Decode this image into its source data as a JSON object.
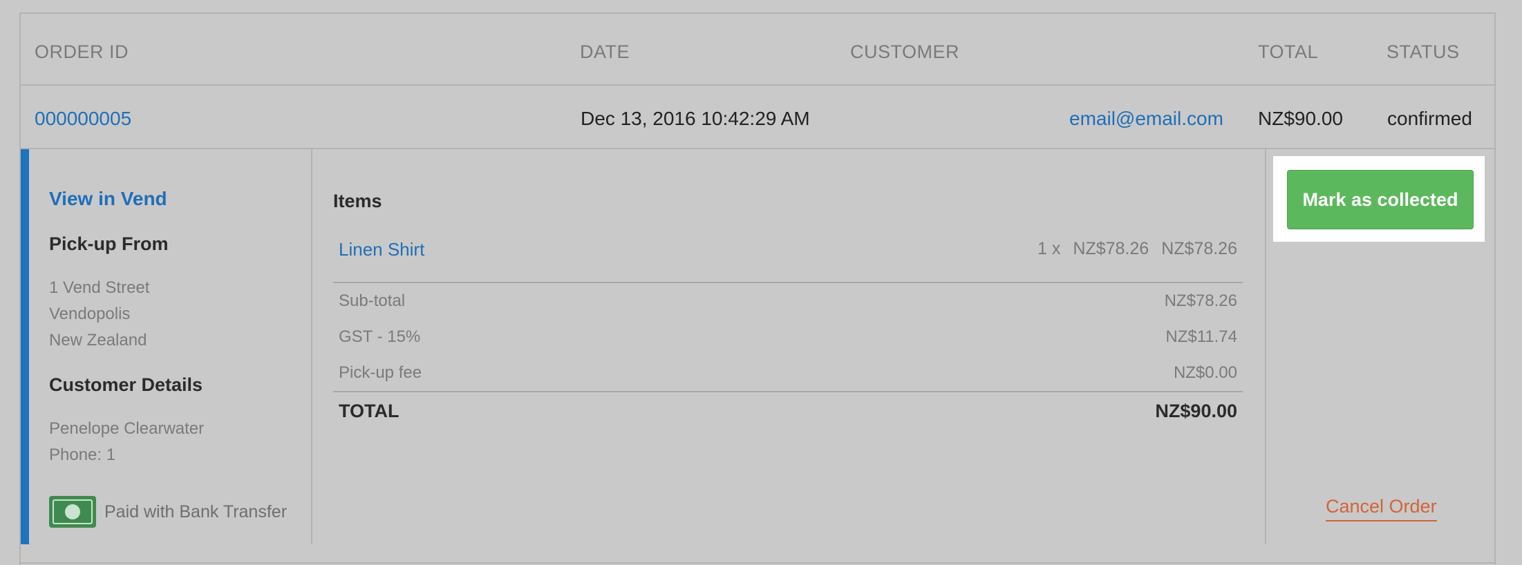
{
  "table": {
    "headers": {
      "order_id": "ORDER ID",
      "date": "DATE",
      "customer": "CUSTOMER",
      "total": "TOTAL",
      "status": "STATUS"
    }
  },
  "order": {
    "id": "000000005",
    "date": "Dec 13, 2016 10:42:29 AM",
    "customer_email": "email@email.com",
    "total": "NZ$90.00",
    "status": "confirmed"
  },
  "details": {
    "view_link": "View in Vend",
    "pickup_heading": "Pick-up From",
    "pickup_address": [
      "1 Vend Street",
      "Vendopolis",
      "New Zealand"
    ],
    "customer_heading": "Customer Details",
    "customer_name": "Penelope Clearwater",
    "customer_phone": "Phone: 1",
    "payment_icon": "money-icon",
    "payment_text": "Paid with Bank Transfer"
  },
  "items": {
    "title": "Items",
    "list": [
      {
        "name": "Linen Shirt",
        "qty": "1 x",
        "unit_price": "NZ$78.26",
        "line_total": "NZ$78.26"
      }
    ],
    "subtotal_label": "Sub-total",
    "subtotal_value": "NZ$78.26",
    "tax_label": "GST - 15%",
    "tax_value": "NZ$11.74",
    "fee_label": "Pick-up fee",
    "fee_value": "NZ$0.00",
    "total_label": "TOTAL",
    "total_value": "NZ$90.00"
  },
  "actions": {
    "collect_label": "Mark as collected",
    "cancel_label": "Cancel Order"
  },
  "colors": {
    "accent": "#1e73be",
    "link": "#1f6fb8",
    "button": "#5cb85c",
    "cancel": "#d2643a"
  }
}
